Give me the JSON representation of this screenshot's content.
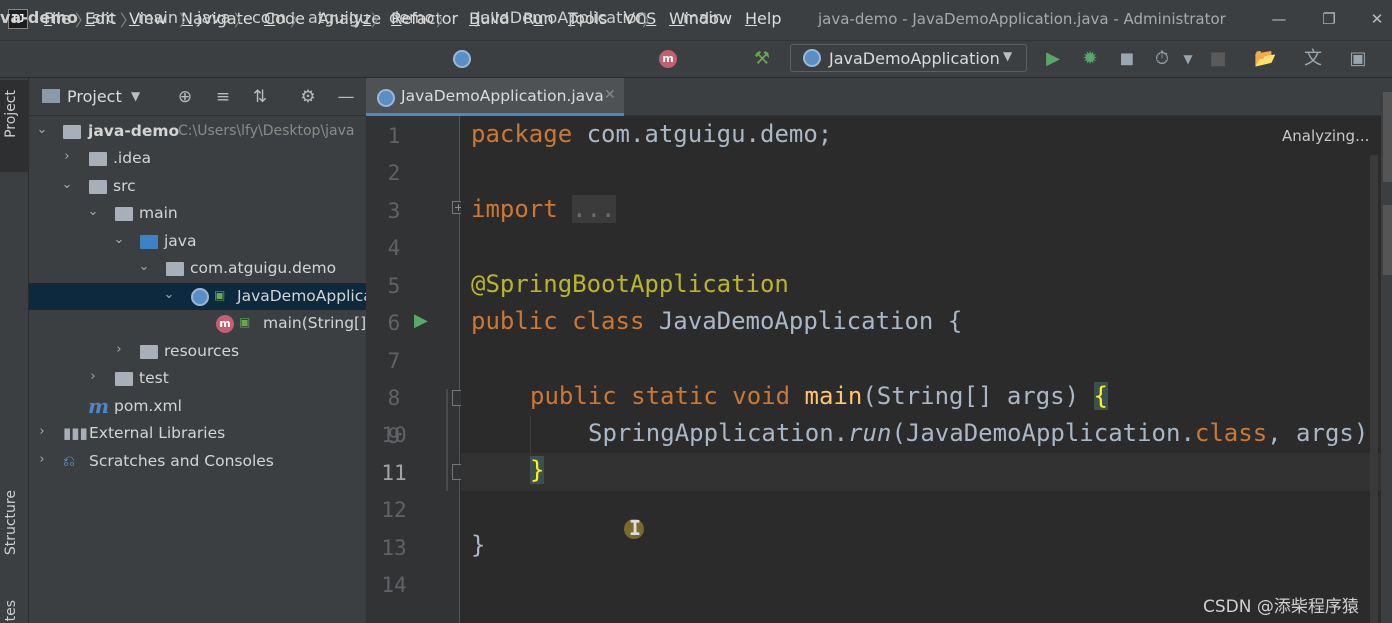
{
  "menu": {
    "items": [
      "File",
      "Edit",
      "View",
      "Navigate",
      "Code",
      "Analyze",
      "Refactor",
      "Build",
      "Run",
      "Tools",
      "VCS",
      "Window",
      "Help"
    ],
    "mnemonics": [
      "F",
      "E",
      "V",
      "N",
      "C",
      "z",
      "R",
      "B",
      "u",
      "T",
      "S",
      "W",
      "H"
    ]
  },
  "window": {
    "title": "java-demo - JavaDemoApplication.java - Administrator"
  },
  "breadcrumbs": [
    "va-demo",
    "src",
    "main",
    "java",
    "com",
    "atguigu",
    "demo",
    "JavaDemoApplication",
    "main"
  ],
  "run_config": {
    "label": "JavaDemoApplication"
  },
  "left_strip": {
    "project_tab": "Project",
    "structure_tab": "Structure",
    "bottom_tab": "tes"
  },
  "project_panel": {
    "title": "Project"
  },
  "tree": [
    {
      "label": "java-demo",
      "path": "C:\\Users\\lfy\\Desktop\\java"
    },
    {
      "label": ".idea"
    },
    {
      "label": "src"
    },
    {
      "label": "main"
    },
    {
      "label": "java"
    },
    {
      "label": "com.atguigu.demo"
    },
    {
      "label": "JavaDemoApplica"
    },
    {
      "label": "main(String[])"
    },
    {
      "label": "resources"
    },
    {
      "label": "test"
    },
    {
      "label": "pom.xml"
    },
    {
      "label": "External Libraries"
    },
    {
      "label": "Scratches and Consoles"
    }
  ],
  "editor": {
    "tab": "JavaDemoApplication.java",
    "status": "Analyzing...",
    "line_numbers": [
      "1",
      "2",
      "3",
      "4",
      "5",
      "6",
      "7",
      "8",
      "9",
      "10",
      "11",
      "12",
      "13",
      "14"
    ],
    "current_line": "11"
  },
  "code": {
    "l1_kw": "package",
    "l1_rest": " com.atguigu.demo;",
    "l3_kw": "import",
    "l3_fold": "...",
    "l6": "@SpringBootApplication",
    "l7_kw": "public class",
    "l7_rest": " JavaDemoApplication {",
    "l9_kw": "public static void",
    "l9_fn": "main",
    "l9_rest": "(String[] args) ",
    "l9_brace": "{",
    "l10_a": "SpringApplication.",
    "l10_run": "run",
    "l10_b": "(JavaDemoApplication.",
    "l10_class": "class",
    "l10_c": ", args)",
    "l11": "}",
    "l13": "}"
  },
  "watermark": "CSDN @添柴程序猿",
  "colors": {
    "keyword": "#cc7832",
    "annotation": "#bbb529",
    "function": "#ffc66d",
    "text": "#a9b7c6",
    "selection": "#0d293e"
  }
}
